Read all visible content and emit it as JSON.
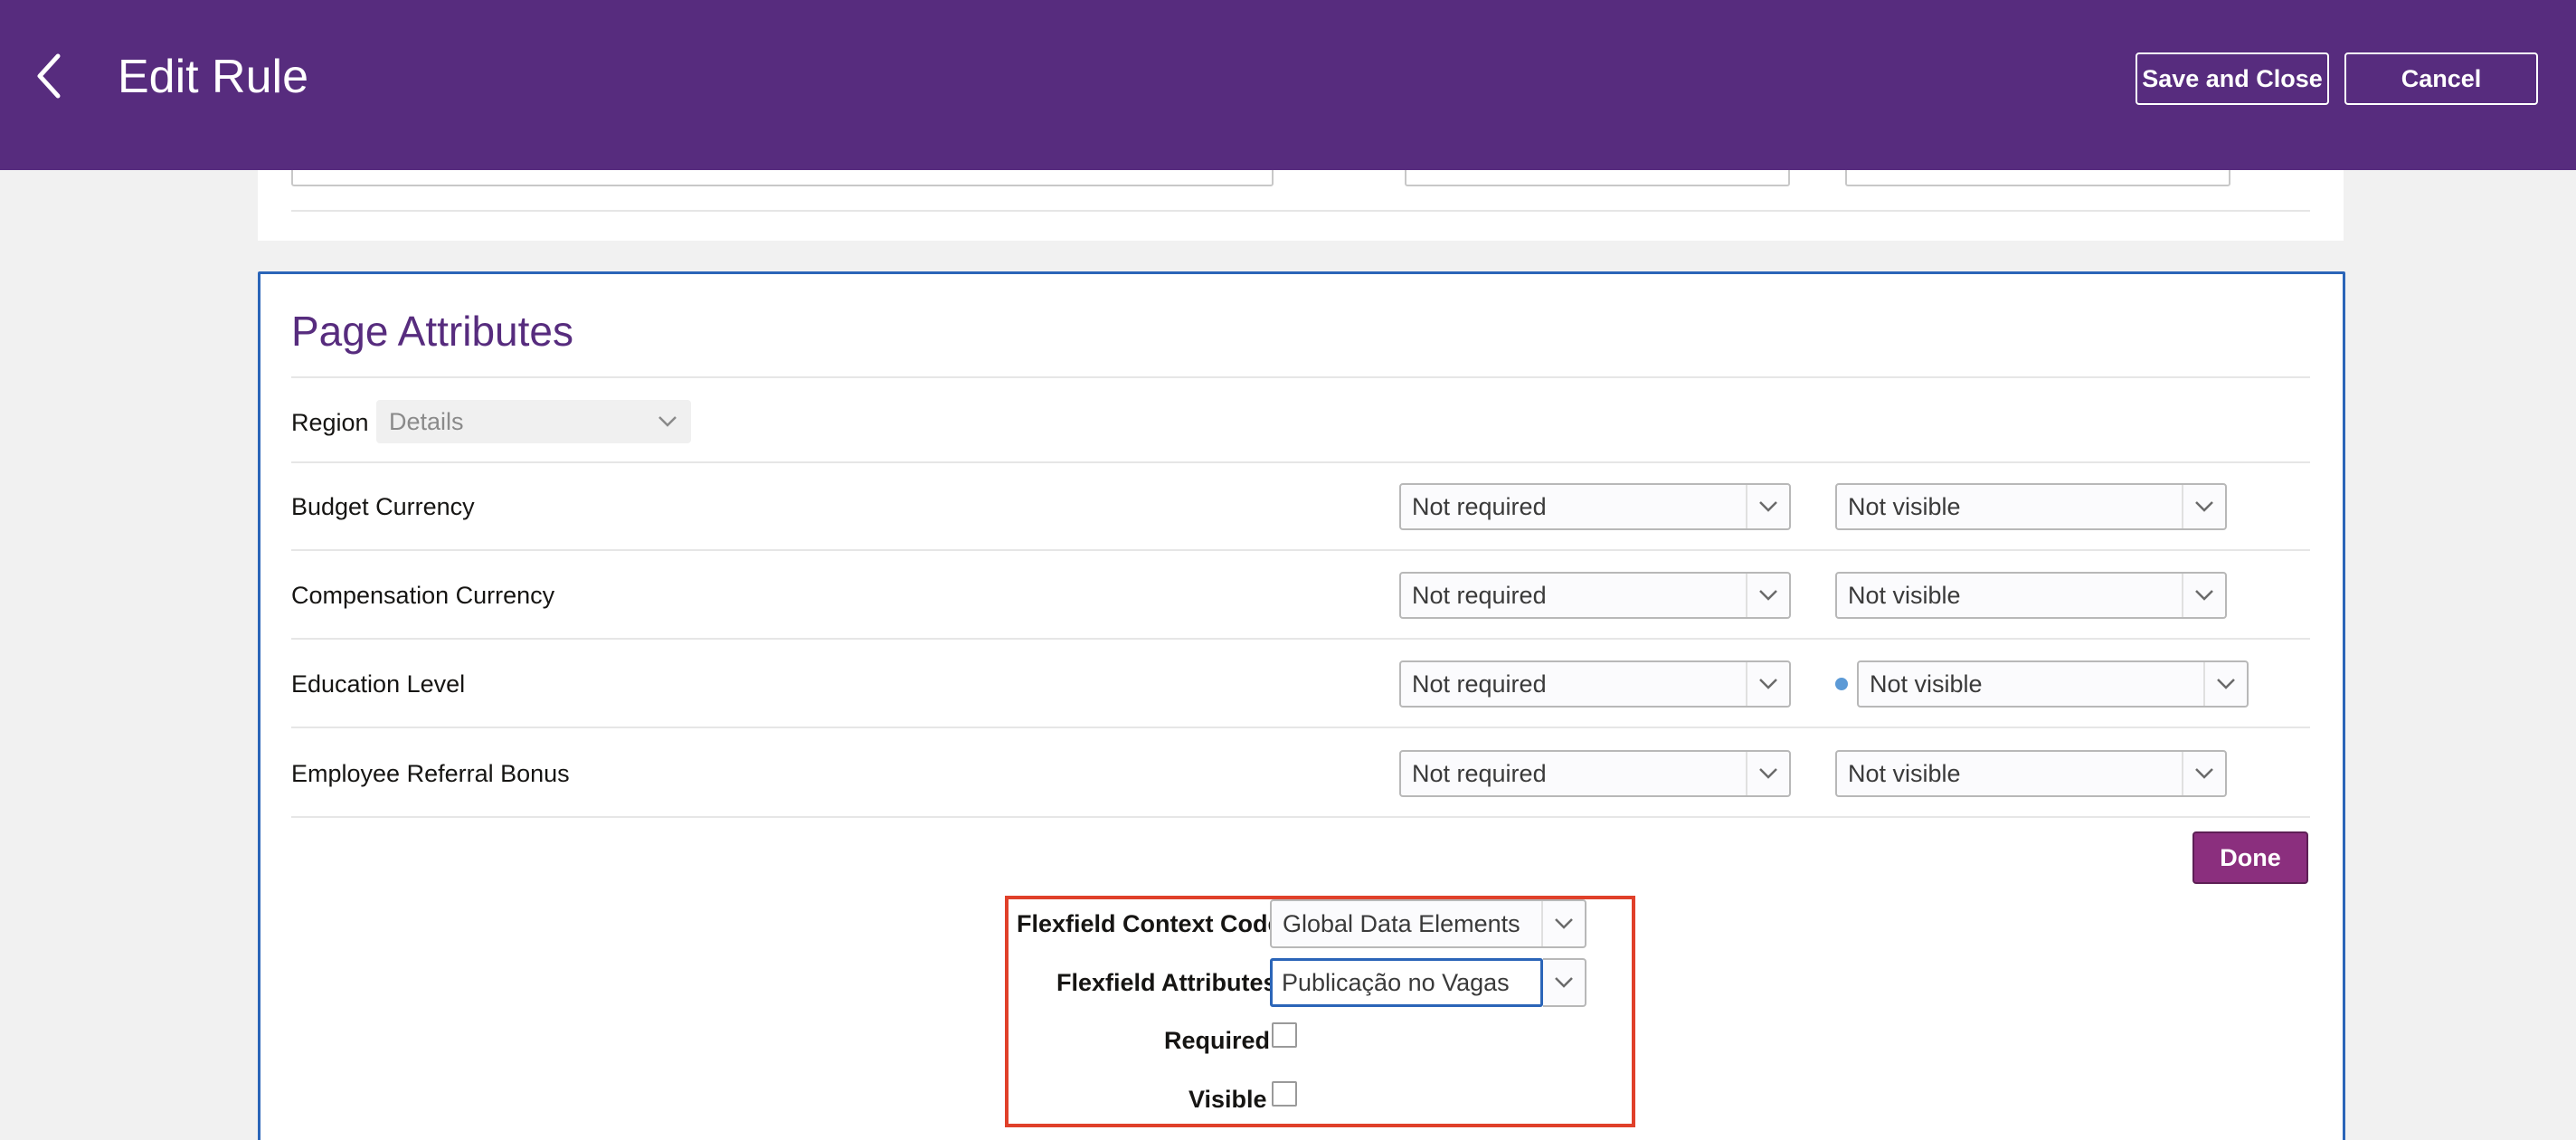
{
  "header": {
    "title": "Edit Rule",
    "save_label": "Save and Close",
    "cancel_label": "Cancel"
  },
  "section": {
    "title": "Page Attributes",
    "region_label": "Region",
    "region_value": "Details"
  },
  "rows": [
    {
      "label": "Budget Currency",
      "required": "Not required",
      "visible": "Not visible"
    },
    {
      "label": "Compensation Currency",
      "required": "Not required",
      "visible": "Not visible"
    },
    {
      "label": "Education Level",
      "required": "Not required",
      "visible": "Not visible"
    },
    {
      "label": "Employee Referral Bonus",
      "required": "Not required",
      "visible": "Not visible"
    }
  ],
  "done_label": "Done",
  "flexfield": {
    "context_label": "Flexfield Context Code",
    "context_value": "Global Data Elements",
    "attributes_label": "Flexfield Attributes",
    "attributes_value": "Publicação no Vagas",
    "required_label": "Required",
    "visible_label": "Visible"
  },
  "colors": {
    "header_bg": "#572c7e",
    "accent_blue": "#2b65b8",
    "done_button": "#8b2f7e",
    "highlight_box": "#e0402a"
  }
}
